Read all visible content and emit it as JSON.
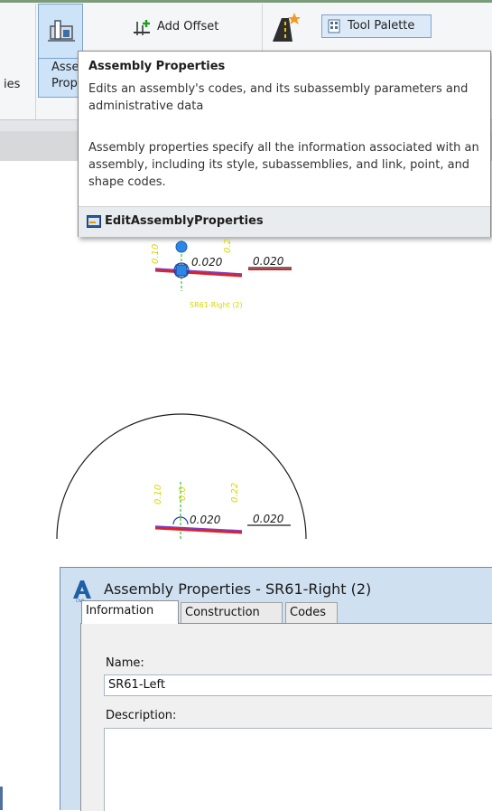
{
  "ribbon": {
    "partial_left_label": "ies",
    "assembly_button_partial_line1": "Asse",
    "assembly_button_partial_line2": "Prop",
    "add_offset_label": "Add Offset",
    "tool_palette_label": "Tool Palette",
    "icons": [
      "assembly-properties-icon",
      "add-offset-icon",
      "road-sparkle-icon",
      "tool-palette-icon"
    ]
  },
  "tooltip": {
    "title": "Assembly Properties",
    "description": "Edits an assembly's codes, and its subassembly parameters and administrative data",
    "details": "Assembly properties specify all the information associated with an assembly, including its style, subassemblies, and link, point, and shape codes.",
    "command": "EditAssemblyProperties"
  },
  "drawing_top": {
    "slope_left": "0.020",
    "slope_right": "0.020",
    "assembly_label": "SR61-Right (2)",
    "vertical_labels": [
      "0.10",
      "0.2"
    ]
  },
  "drawing_circle": {
    "slope_left": "0.020",
    "slope_right": "0.020",
    "vertical_labels": [
      "0.10",
      "0.0",
      "0.22"
    ]
  },
  "dialog": {
    "title": "Assembly Properties - SR61-Right (2)",
    "tabs": [
      "Information",
      "Construction",
      "Codes"
    ],
    "active_tab": "Information",
    "name_label": "Name:",
    "name_value": "SR61-Left",
    "description_label": "Description:",
    "description_value": ""
  },
  "colors": {
    "ribbon_bg": "#f5f6f7",
    "highlight": "#cde3f8",
    "dialog_title_bg": "#cfe0f1",
    "cad_yellow": "#d7d700",
    "cad_red": "#d8232a",
    "cad_purple": "#7b3fc4",
    "cad_blue": "#1e6fd9"
  }
}
